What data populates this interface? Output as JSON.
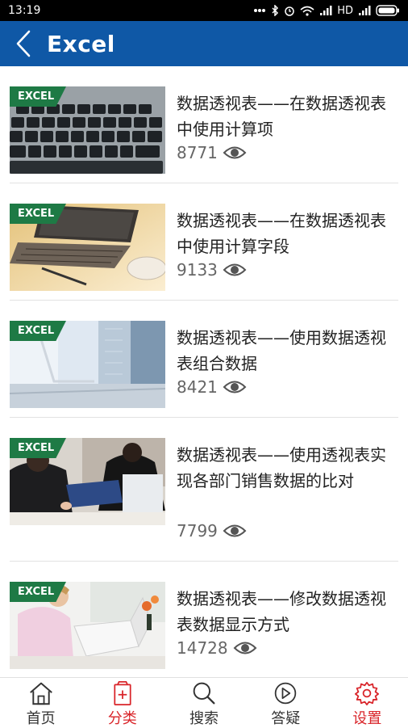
{
  "status": {
    "time": "13:19",
    "network": "HD",
    "icons": [
      "dots-icon",
      "bluetooth-icon",
      "alarm-icon",
      "wifi-icon",
      "signal-icon",
      "signal-icon-2",
      "battery-icon"
    ]
  },
  "header": {
    "title": "Excel",
    "back_icon": "chevron-left-icon"
  },
  "articles": [
    {
      "badge": "EXCEL",
      "title": "数据透视表——在数据透视表中使用计算项",
      "views": "8771",
      "image": "keyboard-photo"
    },
    {
      "badge": "EXCEL",
      "title": "数据透视表——在数据透视表中使用计算字段",
      "views": "9133",
      "image": "laptop-desk-photo"
    },
    {
      "badge": "EXCEL",
      "title": "数据透视表——使用数据透视表组合数据",
      "views": "8421",
      "image": "office-window-photo"
    },
    {
      "badge": "EXCEL",
      "title": "数据透视表——使用透视表实现各部门销售数据的比对",
      "views": "7799",
      "image": "business-meeting-photo"
    },
    {
      "badge": "EXCEL",
      "title": "数据透视表——修改数据透视表数据显示方式",
      "views": "14728",
      "image": "woman-laptop-photo"
    }
  ],
  "tabs": [
    {
      "label": "首页",
      "icon": "home-icon",
      "active": false
    },
    {
      "label": "分类",
      "icon": "category-icon",
      "active": true
    },
    {
      "label": "搜索",
      "icon": "search-icon",
      "active": false
    },
    {
      "label": "答疑",
      "icon": "play-circle-icon",
      "active": false
    },
    {
      "label": "设置",
      "icon": "gear-icon",
      "active": false
    }
  ],
  "colors": {
    "header_bg": "#0f58a6",
    "badge_bg": "#1e7a45",
    "accent_red": "#d9252a",
    "tab_inactive": "#333333",
    "views_gray": "#666666"
  }
}
